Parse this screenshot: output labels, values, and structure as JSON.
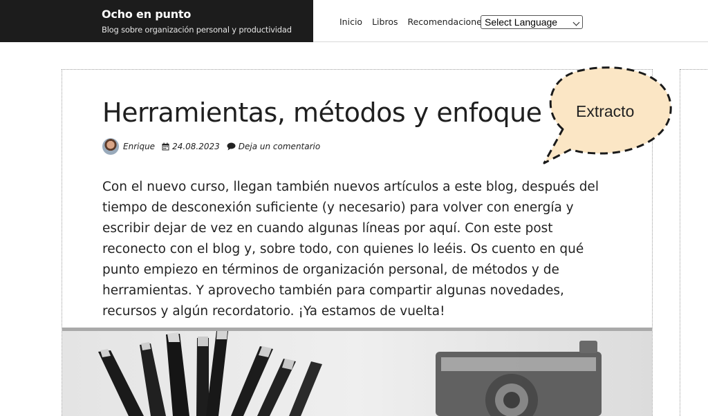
{
  "site": {
    "title": "Ocho en punto",
    "subtitle": "Blog sobre organización personal y productividad"
  },
  "nav": {
    "items": [
      "Inicio",
      "Libros",
      "Recomendaciones"
    ],
    "language_select": "Select Language"
  },
  "post": {
    "title": "Herramientas, métodos y enfoque",
    "author": "Enrique",
    "date": "24.08.2023",
    "comments": "Deja un comentario",
    "excerpt": "Con el nuevo curso, llegan también nuevos artículos a este blog, después del tiempo de desconexión suficiente (y necesario) para volver con energía y escribir dejar de vez en cuando algunas líneas por aquí. Con este post reconecto con el blog y, sobre todo, con quienes lo leéis. Os cuento en qué punto empiezo en términos de organización personal, de métodos y de herramientas. Y aprovecho también para compartir algunas novedades, recursos y algún recordatorio. ¡Ya estamos de vuelta!"
  },
  "callout": {
    "label": "Extracto",
    "fill_color": "#fbe6c5"
  },
  "icons": [
    "calendar-icon",
    "comment-icon",
    "chevron-down-icon"
  ],
  "colors": {
    "header_bg": "#1c1c1c"
  }
}
